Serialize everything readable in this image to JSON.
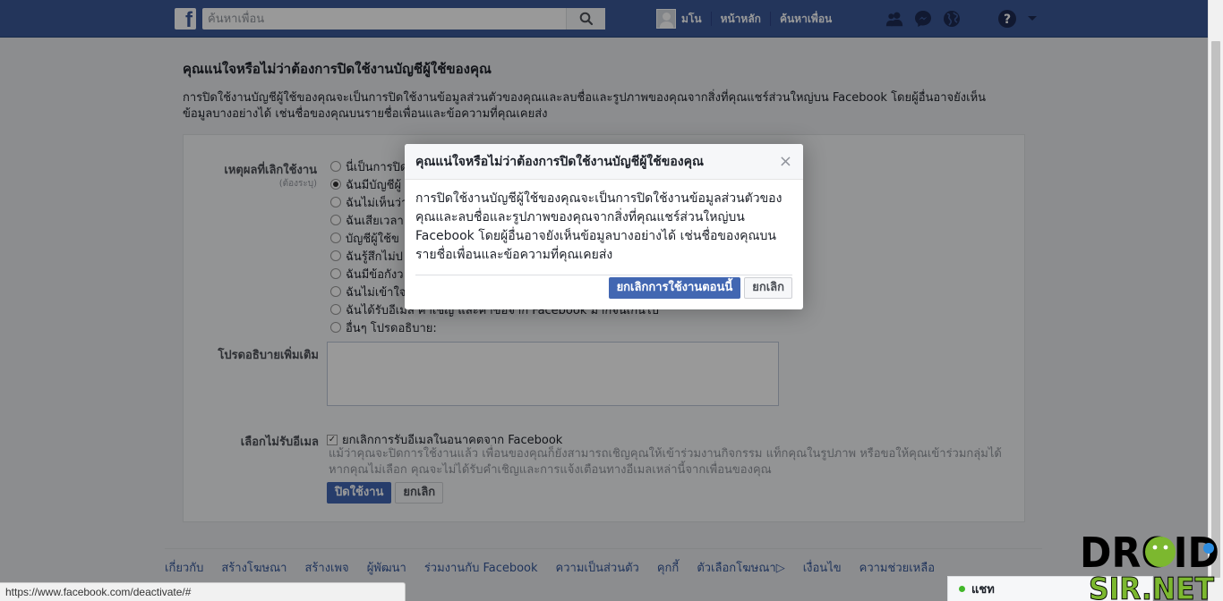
{
  "topbar": {
    "logo": "f",
    "search_placeholder": "ค้นหาเพื่อน",
    "user_name": "มโน",
    "home": "หน้าหลัก",
    "find_friends": "ค้นหาเพื่อน"
  },
  "page": {
    "title": "คุณแน่ใจหรือไม่ว่าต้องการปิดใช้งานบัญชีผู้ใช้ของคุณ",
    "description": "การปิดใช้งานบัญชีผู้ใช้ของคุณจะเป็นการปิดใช้งานข้อมูลส่วนตัวของคุณและลบชื่อและรูปภาพของคุณจากสิ่งที่คุณแชร์ส่วนใหญ่บน Facebook โดยผู้อื่นอาจยังเห็นข้อมูลบางอย่างได้ เช่นชื่อของคุณบนรายชื่อเพื่อนและข้อความที่คุณเคยส่ง"
  },
  "form": {
    "reason_label": "เหตุผลที่เลิกใช้งาน",
    "required_label": "(ต้องระบุ)",
    "reasons": [
      {
        "label": "นี่เป็นการปิด",
        "checked": false
      },
      {
        "label": "ฉันมีบัญชีผู้",
        "checked": true
      },
      {
        "label": "ฉันไม่เห็นว่า",
        "checked": false
      },
      {
        "label": "ฉันเสียเวลา",
        "checked": false
      },
      {
        "label": "บัญชีผู้ใช้ข",
        "checked": false
      },
      {
        "label": "ฉันรู้สึกไม่ป",
        "checked": false
      },
      {
        "label": "ฉันมีข้อกังว",
        "checked": false
      },
      {
        "label": "ฉันไม่เข้าใจ",
        "checked": false
      },
      {
        "label": "ฉันได้รับอีเมล คำเชิญ และคำขอจาก Facebook มากจนเกินไป",
        "checked": false
      },
      {
        "label": "อื่นๆ โปรดอธิบาย:",
        "checked": false
      }
    ],
    "explain_label": "โปรดอธิบายเพิ่มเติม",
    "optout_label": "เลือกไม่รับอีเมล",
    "optout_checkbox": "ยกเลิกการรับอีเมลในอนาคตจาก Facebook",
    "optout_note": "แม้ว่าคุณจะปิดการใช้งานแล้ว เพื่อนของคุณก็ยังสามารถเชิญคุณให้เข้าร่วมงานกิจกรรม แท็กคุณในรูปภาพ หรือขอให้คุณเข้าร่วมกลุ่มได้ หากคุณไม่เลือก คุณจะไม่ได้รับคำเชิญและการแจ้งเตือนทางอีเมลเหล่านี้จากเพื่อนของคุณ",
    "deactivate_button": "ปิดใช้งาน",
    "cancel_button": "ยกเลิก"
  },
  "modal": {
    "title": "คุณแน่ใจหรือไม่ว่าต้องการปิดใช้งานบัญชีผู้ใช้ของคุณ",
    "close": "×",
    "body": "การปิดใช้งานบัญชีผู้ใช้ของคุณจะเป็นการปิดใช้งานข้อมูลส่วนตัวของคุณและลบชื่อและรูปภาพของคุณจากสิ่งที่คุณแชร์ส่วนใหญ่บน Facebook โดยผู้อื่นอาจยังเห็นข้อมูลบางอย่างได้ เช่นชื่อของคุณบนรายชื่อเพื่อนและข้อความที่คุณเคยส่ง",
    "confirm_button": "ยกเลิกการใช้งานตอนนี้",
    "cancel_button": "ยกเลิก"
  },
  "footer": {
    "links": [
      "เกี่ยวกับ",
      "สร้างโฆษณา",
      "สร้างเพจ",
      "ผู้พัฒนา",
      "ร่วมงานกับ Facebook",
      "ความเป็นส่วนตัว",
      "คุกกี้",
      "ตัวเลือกโฆษณา▷",
      "เงื่อนไข",
      "ความช่วยเหลือ"
    ]
  },
  "status_url": "https://www.facebook.com/deactivate/#",
  "chat": {
    "label": "แชท"
  },
  "watermark": {
    "line1": "DROID",
    "line2": "SIR.NET"
  },
  "colors": {
    "brand": "#3b5998",
    "primary_button": "#4267b2",
    "online": "#42b72a",
    "watermark_green": "#7cb82f"
  }
}
